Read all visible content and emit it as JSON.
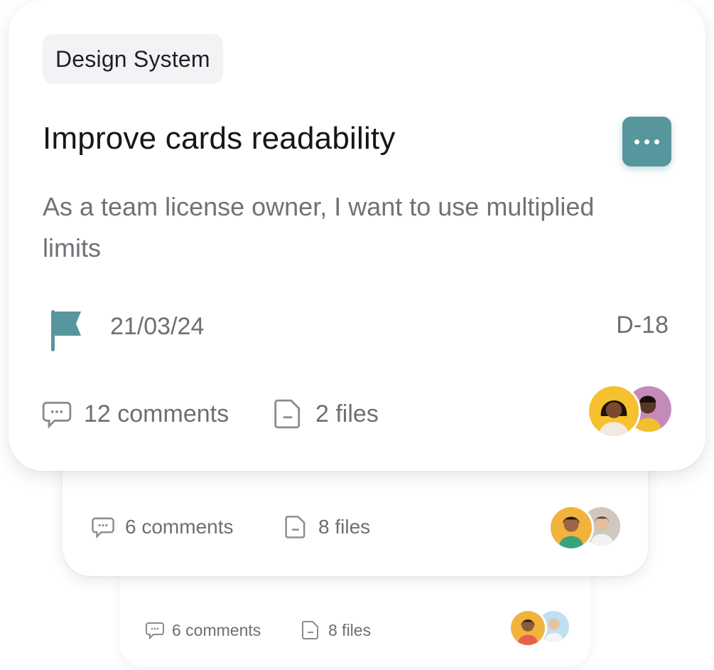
{
  "cards": {
    "front": {
      "tag": "Design System",
      "title": "Improve cards readability",
      "description": "As a team license owner, I want to use multiplied limits",
      "due_date": "21/03/24",
      "days_left": "D-18",
      "comments": "12 comments",
      "files": "2 files",
      "menu_icon": "more-horizontal-icon",
      "flag_color": "#57969c"
    },
    "middle": {
      "comments": "6 comments",
      "files": "8 files"
    },
    "back": {
      "comments": "6 comments",
      "files": "8 files"
    }
  },
  "colors": {
    "accent": "#57969c",
    "tag_background": "#f3f3f5",
    "muted_text": "#6e6e74"
  }
}
